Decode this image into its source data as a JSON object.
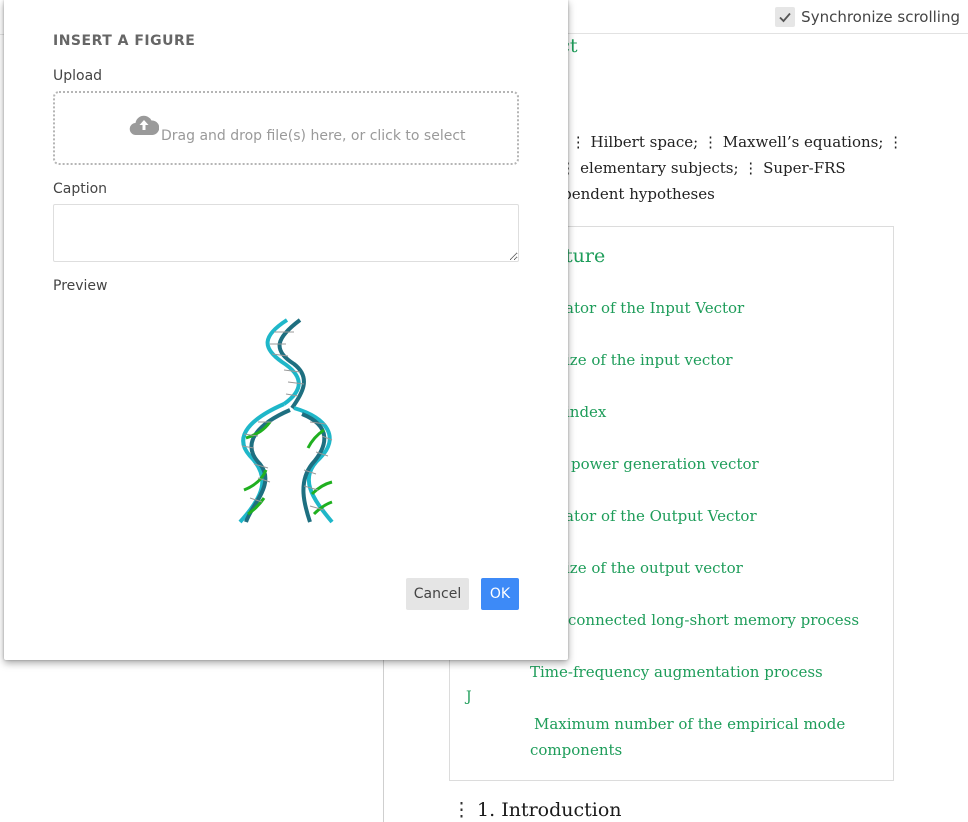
{
  "toolbar": {
    "sync_label": "Synchronize scrolling",
    "sync_checked": true
  },
  "preview": {
    "title_fragment": "ostract",
    "keywords_line1": "tics;  ⋮ Hilbert space;  ⋮ Maxwell’s equations;  ⋮",
    "keywords_line2": "se;  ⋮ elementary subjects;  ⋮ Super-FRS",
    "keywords_line3": "ndependent hypotheses",
    "nomenclature_title": "ture",
    "nomenclature_items": [
      "ator of the Input Vector",
      "ize of the input vector",
      "index",
      "power generation vector",
      "ator of the Output Vector",
      "ize of the output vector",
      "connected long-short memory process",
      "Time-frequency augmentation process",
      "Maximum number of the empirical mode",
      "components"
    ],
    "nomenclature_symbol_j": "J",
    "section_heading": "1. Introduction",
    "section_marker": "⋮"
  },
  "modal": {
    "title": "INSERT A FIGURE",
    "upload_label": "Upload",
    "dropzone_text": "Drag and drop file(s) here, or click to select",
    "dropzone_icon": "cloud-upload-icon",
    "caption_label": "Caption",
    "caption_value": "",
    "preview_label": "Preview",
    "preview_image": "dna-double-helix-replication",
    "cancel_label": "Cancel",
    "ok_label": "OK"
  },
  "colors": {
    "accent_green": "#1e9d5a",
    "ok_blue": "#3d8af7",
    "cancel_gray": "#e5e5e5"
  }
}
